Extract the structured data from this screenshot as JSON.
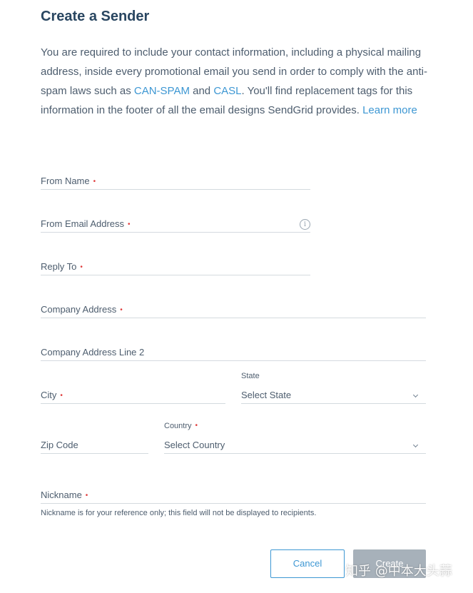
{
  "page": {
    "title": "Create a Sender",
    "intro": {
      "text_1": "You are required to include your contact information, including a physical mailing address, inside every promotional email you send in order to comply with the anti-spam laws such as ",
      "link_can_spam": "CAN-SPAM",
      "text_and": " and ",
      "link_casl": "CASL",
      "text_2": ". You'll find replacement tags for this information in the footer of all the email designs SendGrid provides. ",
      "link_learn_more": "Learn more"
    }
  },
  "form": {
    "from_name": {
      "label": "From Name",
      "required": "•"
    },
    "from_email": {
      "label": "From Email Address",
      "required": "•",
      "info_icon": "i"
    },
    "reply_to": {
      "label": "Reply To",
      "required": "•"
    },
    "company_address": {
      "label": "Company Address",
      "required": "•"
    },
    "company_address_2": {
      "label": "Company Address Line 2"
    },
    "city": {
      "label": "City",
      "required": "•"
    },
    "state": {
      "label": "State",
      "value": "Select State"
    },
    "zip": {
      "label": "Zip Code"
    },
    "country": {
      "label": "Country",
      "required": "•",
      "value": "Select Country"
    },
    "nickname": {
      "label": "Nickname",
      "required": "•",
      "help": "Nickname is for your reference only; this field will not be displayed to recipients."
    }
  },
  "actions": {
    "cancel_label": "Cancel",
    "create_label": "Create"
  },
  "watermark": {
    "text": "知乎 @中本大头蒜"
  },
  "colors": {
    "heading": "#294661",
    "body_text": "#4d5d6e",
    "link": "#3d97d3",
    "required": "#e03e3e",
    "border": "#d4dadf",
    "disabled_button": "#a7b1ba"
  },
  "icons": {
    "info": "info-icon",
    "select_chevron": "chevron-down-icon"
  }
}
